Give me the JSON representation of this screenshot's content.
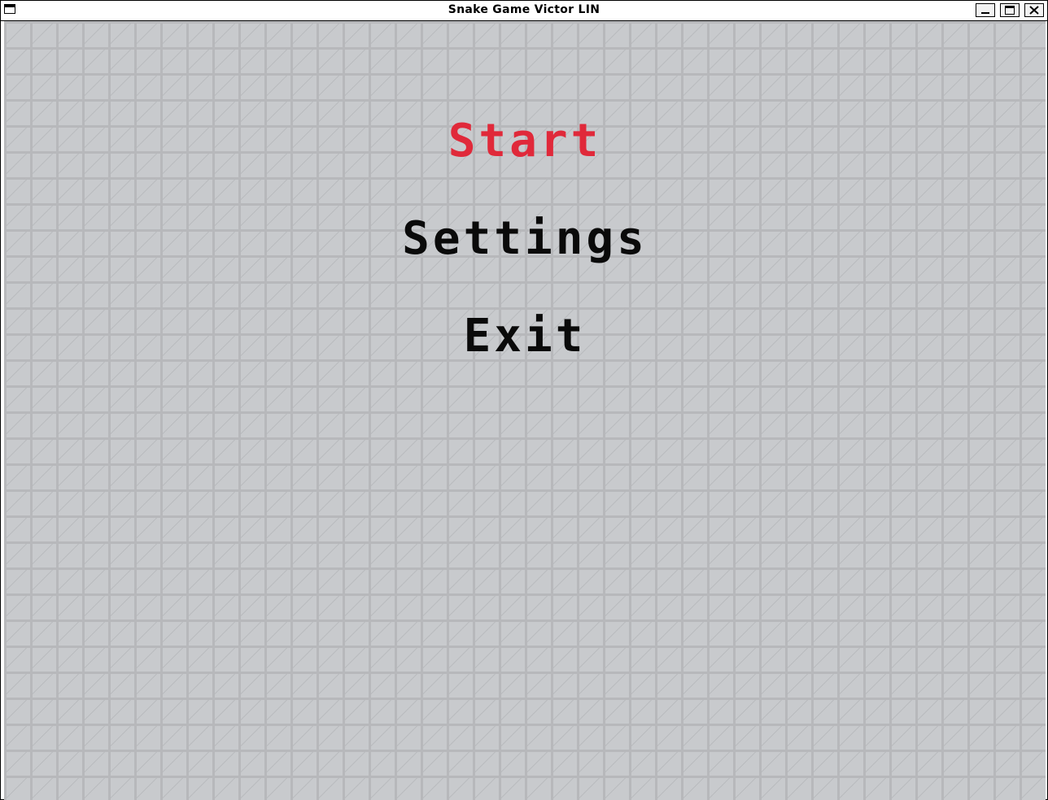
{
  "window": {
    "title": "Snake Game Victor LIN",
    "controls": {
      "minimize_icon": "minimize-icon",
      "maximize_icon": "maximize-icon",
      "close_icon": "close-icon"
    }
  },
  "menu": {
    "items": [
      {
        "label": "Start",
        "selected": true,
        "color": "#e0293a"
      },
      {
        "label": "Settings",
        "selected": false,
        "color": "#0a0a0a"
      },
      {
        "label": "Exit",
        "selected": false,
        "color": "#0a0a0a"
      }
    ]
  },
  "colors": {
    "background": "#c8cacd",
    "grid_line": "#b7b8bb",
    "highlight": "#e0293a",
    "text": "#0a0a0a"
  }
}
